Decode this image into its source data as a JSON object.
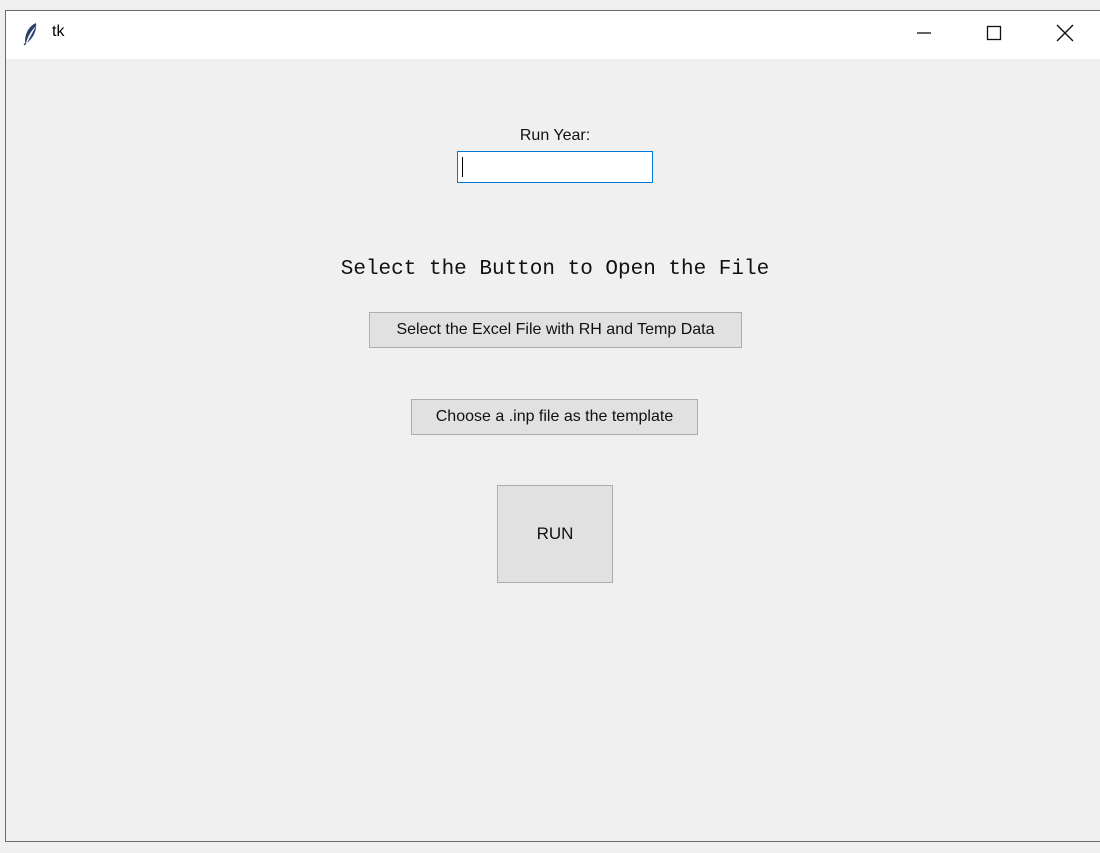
{
  "window": {
    "title": "tk",
    "icons": {
      "app": "feather-icon",
      "minimize": "minimize-icon",
      "maximize": "maximize-icon",
      "close": "close-icon"
    }
  },
  "form": {
    "run_year_label": "Run Year:",
    "run_year_value": "",
    "instruction": "Select the Button to Open the File",
    "excel_button": "Select the Excel File with RH and Temp Data",
    "inp_button": "Choose a .inp file as the template",
    "run_button": "RUN"
  },
  "colors": {
    "background": "#f0f0f0",
    "titlebar": "#ffffff",
    "button_face": "#e1e1e1",
    "focus_border": "#0078d7"
  }
}
